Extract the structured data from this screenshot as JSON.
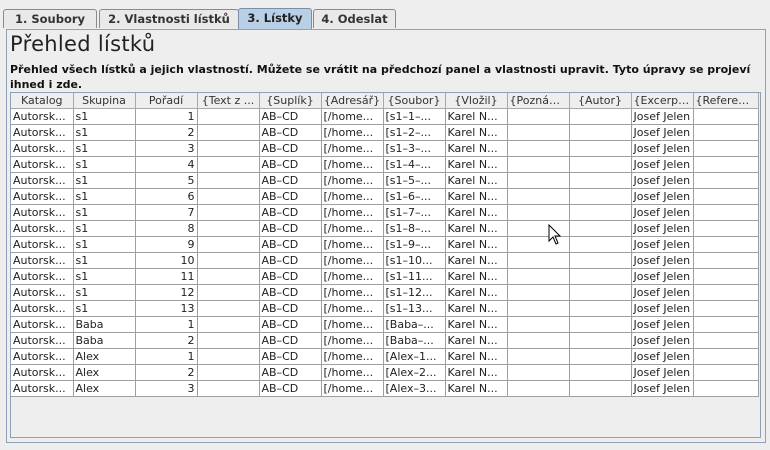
{
  "tabs": [
    {
      "label": "1. Soubory",
      "active": false
    },
    {
      "label": "2. Vlastnosti lístků",
      "active": false
    },
    {
      "label": "3. Lístky",
      "active": true
    },
    {
      "label": "4. Odeslat",
      "active": false
    }
  ],
  "panel": {
    "title": "Přehled lístků",
    "description": "Přehled všech lístků a jejich vlastností. Můžete se vrátit na předchozí panel a vlastnosti upravit. Tyto úpravy se projeví ihned i zde."
  },
  "table": {
    "columns": [
      "Katalog",
      "Skupina",
      "Pořadí",
      "{Text z ...",
      "{Suplík}",
      "{Adresář}",
      "{Soubor}",
      "{Vložil}",
      "{Poznám...",
      "{Autor}",
      "{Excerpt...",
      "{Referen..."
    ],
    "rows": [
      [
        "Autorsk...",
        "s1",
        "1",
        "",
        "AB–CD",
        "[/home...",
        "[s1–1–...",
        "Karel N...",
        "",
        "",
        "Josef Jelen",
        ""
      ],
      [
        "Autorsk...",
        "s1",
        "2",
        "",
        "AB–CD",
        "[/home...",
        "[s1–2–...",
        "Karel N...",
        "",
        "",
        "Josef Jelen",
        ""
      ],
      [
        "Autorsk...",
        "s1",
        "3",
        "",
        "AB–CD",
        "[/home...",
        "[s1–3–...",
        "Karel N...",
        "",
        "",
        "Josef Jelen",
        ""
      ],
      [
        "Autorsk...",
        "s1",
        "4",
        "",
        "AB–CD",
        "[/home...",
        "[s1–4–...",
        "Karel N...",
        "",
        "",
        "Josef Jelen",
        ""
      ],
      [
        "Autorsk...",
        "s1",
        "5",
        "",
        "AB–CD",
        "[/home...",
        "[s1–5–...",
        "Karel N...",
        "",
        "",
        "Josef Jelen",
        ""
      ],
      [
        "Autorsk...",
        "s1",
        "6",
        "",
        "AB–CD",
        "[/home...",
        "[s1–6–...",
        "Karel N...",
        "",
        "",
        "Josef Jelen",
        ""
      ],
      [
        "Autorsk...",
        "s1",
        "7",
        "",
        "AB–CD",
        "[/home...",
        "[s1–7–...",
        "Karel N...",
        "",
        "",
        "Josef Jelen",
        ""
      ],
      [
        "Autorsk...",
        "s1",
        "8",
        "",
        "AB–CD",
        "[/home...",
        "[s1–8–...",
        "Karel N...",
        "",
        "",
        "Josef Jelen",
        ""
      ],
      [
        "Autorsk...",
        "s1",
        "9",
        "",
        "AB–CD",
        "[/home...",
        "[s1–9–...",
        "Karel N...",
        "",
        "",
        "Josef Jelen",
        ""
      ],
      [
        "Autorsk...",
        "s1",
        "10",
        "",
        "AB–CD",
        "[/home...",
        "[s1–10...",
        "Karel N...",
        "",
        "",
        "Josef Jelen",
        ""
      ],
      [
        "Autorsk...",
        "s1",
        "11",
        "",
        "AB–CD",
        "[/home...",
        "[s1–11...",
        "Karel N...",
        "",
        "",
        "Josef Jelen",
        ""
      ],
      [
        "Autorsk...",
        "s1",
        "12",
        "",
        "AB–CD",
        "[/home...",
        "[s1–12...",
        "Karel N...",
        "",
        "",
        "Josef Jelen",
        ""
      ],
      [
        "Autorsk...",
        "s1",
        "13",
        "",
        "AB–CD",
        "[/home...",
        "[s1–13...",
        "Karel N...",
        "",
        "",
        "Josef Jelen",
        ""
      ],
      [
        "Autorsk...",
        "Baba",
        "1",
        "",
        "AB–CD",
        "[/home...",
        "[Baba–...",
        "Karel N...",
        "",
        "",
        "Josef Jelen",
        ""
      ],
      [
        "Autorsk...",
        "Baba",
        "2",
        "",
        "AB–CD",
        "[/home...",
        "[Baba–...",
        "Karel N...",
        "",
        "",
        "Josef Jelen",
        ""
      ],
      [
        "Autorsk...",
        "Alex",
        "1",
        "",
        "AB–CD",
        "[/home...",
        "[Alex–1...",
        "Karel N...",
        "",
        "",
        "Josef Jelen",
        ""
      ],
      [
        "Autorsk...",
        "Alex",
        "2",
        "",
        "AB–CD",
        "[/home...",
        "[Alex–2...",
        "Karel N...",
        "",
        "",
        "Josef Jelen",
        ""
      ],
      [
        "Autorsk...",
        "Alex",
        "3",
        "",
        "AB–CD",
        "[/home...",
        "[Alex–3...",
        "Karel N...",
        "",
        "",
        "Josef Jelen",
        ""
      ]
    ]
  },
  "colors": {
    "active_tab": "#b8cfe5",
    "panel_border": "#8fa1b7",
    "cell_background": "#ffffff",
    "grid_line": "#a0a0a0"
  },
  "icons": {
    "pointer": "arrow-cursor-icon"
  }
}
